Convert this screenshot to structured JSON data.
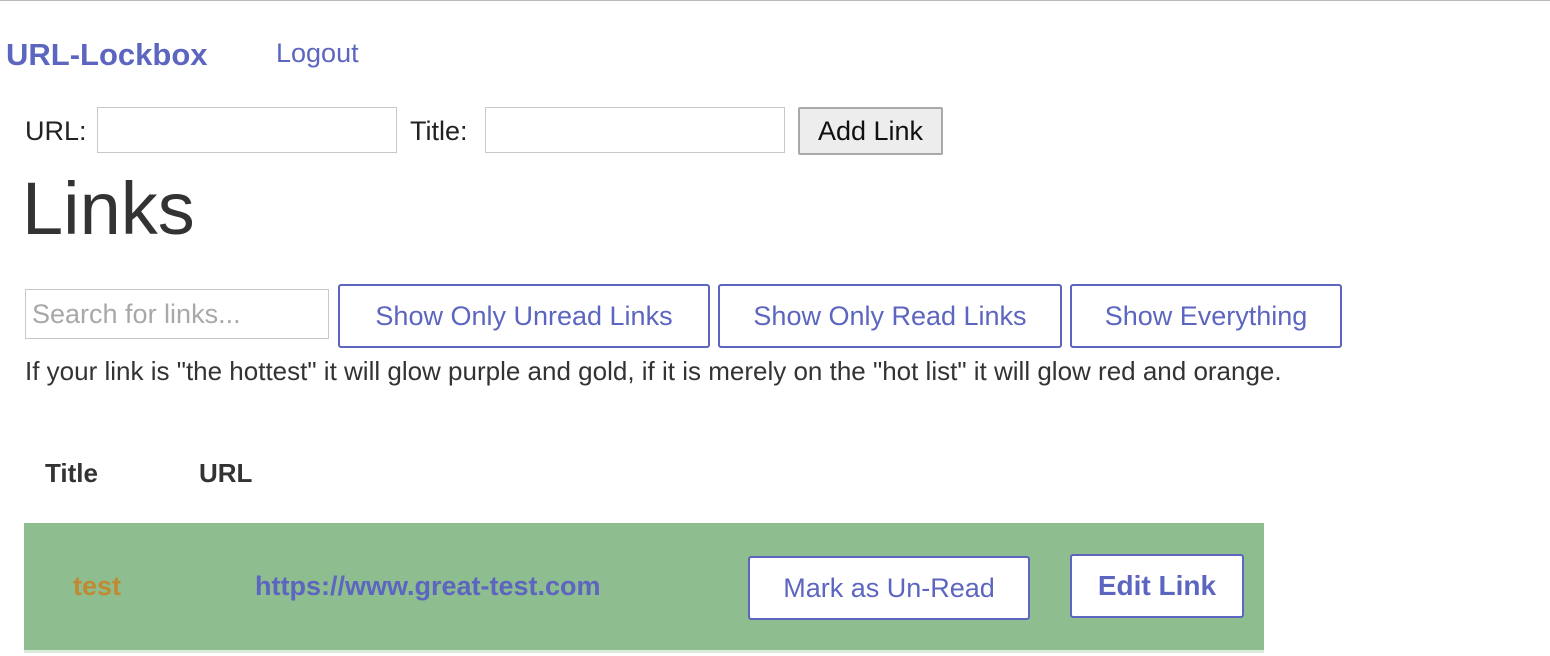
{
  "nav": {
    "brand": "URL-Lockbox",
    "logout": "Logout"
  },
  "add_form": {
    "url_label": "URL:",
    "url_value": "",
    "title_label": "Title:",
    "title_value": "",
    "submit_label": "Add Link"
  },
  "page_title": "Links",
  "filters": {
    "search_placeholder": "Search for links...",
    "search_value": "",
    "buttons": [
      {
        "label": "Show Only Unread Links"
      },
      {
        "label": "Show Only Read Links"
      },
      {
        "label": "Show Everything"
      }
    ]
  },
  "hint_text": "If your link is \"the hottest\" it will glow purple and gold, if it is merely on the \"hot list\" it will glow red and orange.",
  "table": {
    "headers": [
      "Title",
      "URL"
    ],
    "rows": [
      {
        "title": "test",
        "url": "https://www.great-test.com",
        "toggle_label": "Mark as Un-Read",
        "edit_label": "Edit Link",
        "row_color": "#8ebd8f"
      }
    ]
  },
  "colors": {
    "accent": "#5c65bf",
    "read_row": "#8ebd8f",
    "title_text": "#c08a33"
  }
}
